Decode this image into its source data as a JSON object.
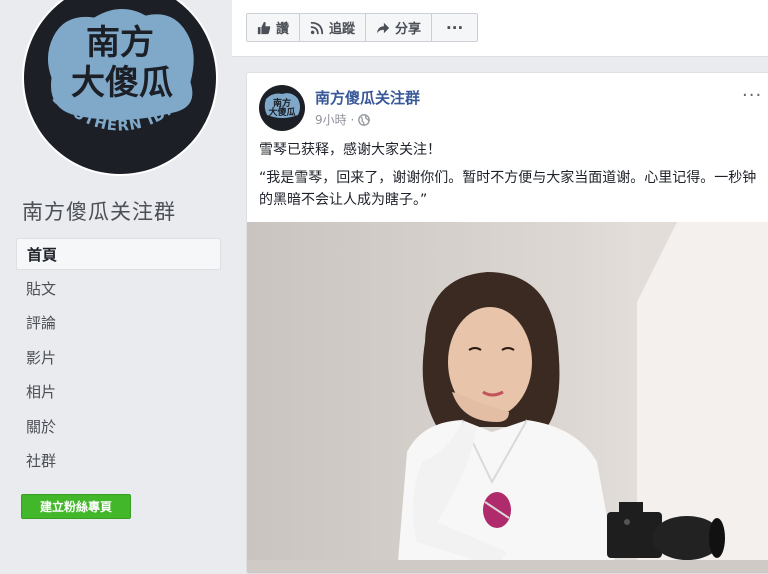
{
  "page": {
    "name": "南方傻瓜关注群",
    "logo_text_main": "南方大傻瓜",
    "logo_text_sub": "SOUTHERN IDIOT"
  },
  "nav": {
    "items": [
      {
        "label": "首頁",
        "active": true
      },
      {
        "label": "貼文"
      },
      {
        "label": "評論"
      },
      {
        "label": "影片"
      },
      {
        "label": "相片"
      },
      {
        "label": "關於"
      },
      {
        "label": "社群"
      }
    ],
    "create_button": "建立粉絲專頁"
  },
  "actions": {
    "like": "讚",
    "follow": "追蹤",
    "share": "分享",
    "more": "···"
  },
  "post": {
    "author": "南方傻瓜关注群",
    "time": "9小時 ·",
    "more": "···",
    "line1": "雪琴已获释，感谢大家关注！",
    "line2": "“我是雪琴，回来了，谢谢你们。暂时不方便与大家当面道谢。心里记得。一秒钟的黑暗不会让人成为瞎子。”"
  },
  "colors": {
    "logo_blue": "#7fa8c9",
    "logo_dark": "#1c1f26",
    "link": "#385898",
    "create_green": "#42b72a"
  }
}
